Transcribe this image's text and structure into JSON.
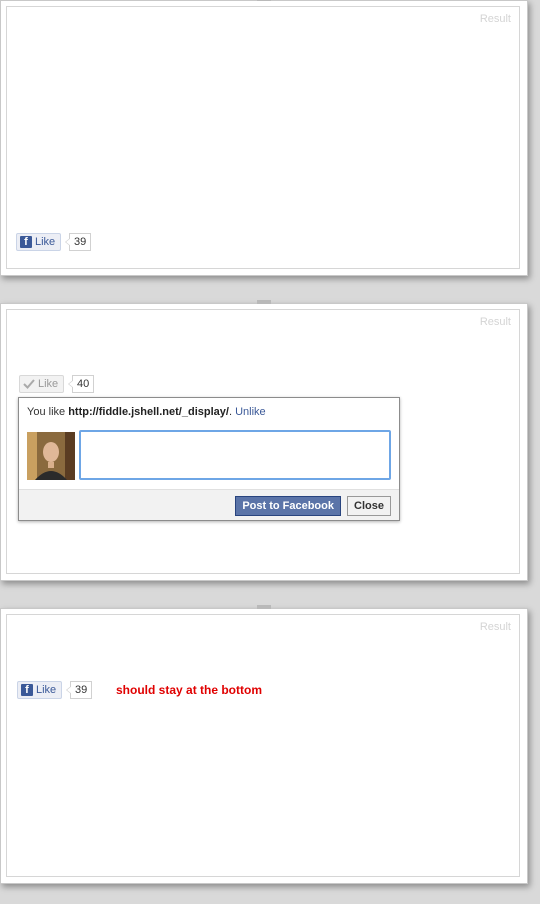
{
  "panels": [
    {
      "result_label": "Result",
      "like_label": "Like",
      "like_count": "39"
    },
    {
      "result_label": "Result",
      "like_label": "Like",
      "like_count": "40",
      "popup": {
        "you_like_text": "You like",
        "url": "http://fiddle.jshell.net/_display/",
        "period": ".",
        "unlike_link": "Unlike",
        "comment_value": "",
        "post_button": "Post to Facebook",
        "close_button": "Close"
      }
    },
    {
      "result_label": "Result",
      "like_label": "Like",
      "like_count": "39",
      "note": "should stay at the bottom"
    }
  ],
  "colors": {
    "facebook_blue": "#3b5998",
    "note_red": "#e00000",
    "textarea_focus": "#6ea6e6"
  },
  "icons": {
    "facebook": "facebook-f-icon",
    "liked": "check-icon"
  }
}
